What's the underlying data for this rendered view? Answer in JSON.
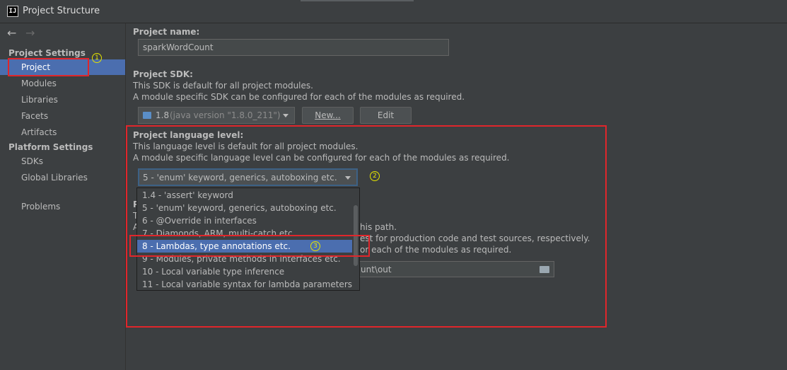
{
  "window": {
    "title": "Project Structure",
    "app_icon_text": "IJ"
  },
  "nav": {
    "back_icon": "arrow-left-icon",
    "forward_icon": "arrow-right-icon"
  },
  "sidebar": {
    "project_settings_header": "Project Settings",
    "project_items": [
      "Project",
      "Modules",
      "Libraries",
      "Facets",
      "Artifacts"
    ],
    "platform_settings_header": "Platform Settings",
    "platform_items": [
      "SDKs",
      "Global Libraries"
    ],
    "problems": "Problems",
    "selected": "Project"
  },
  "project_name": {
    "label": "Project name:",
    "value": "sparkWordCount"
  },
  "sdk": {
    "label": "Project SDK:",
    "desc1": "This SDK is default for all project modules.",
    "desc2": "A module specific SDK can be configured for each of the modules as required.",
    "selected_version": "1.8",
    "selected_detail": "(java version \"1.8.0_211\")",
    "new_button": "New...",
    "edit_button": "Edit"
  },
  "language_level": {
    "label": "Project language level:",
    "desc1": "This language level is default for all project modules.",
    "desc2": "A module specific language level can be configured for each of the modules as required.",
    "selected": "5 - 'enum' keyword, generics, autoboxing etc.",
    "options": [
      "1.4 - 'assert' keyword",
      "5 - 'enum' keyword, generics, autoboxing etc.",
      "6 - @Override in interfaces",
      "7 - Diamonds, ARM, multi-catch etc.",
      "8 - Lambdas, type annotations etc.",
      "9 - Modules, private methods in interfaces etc.",
      "10 - Local variable type inference",
      "11 - Local variable syntax for lambda parameters"
    ],
    "highlighted": "8 - Lambdas, type annotations etc."
  },
  "compiler_output": {
    "label_fragment": "P",
    "line_fragment_t": "T",
    "line_fragment_a": "A",
    "line1_tail": "his path.",
    "line2_tail": "est for production code and test sources, respectively.",
    "line3_tail": "or each of the modules as required.",
    "path_tail": "unt\\out",
    "folder_icon": "folder-icon"
  },
  "annotations": {
    "m1": "1",
    "m2": "2",
    "m3": "3"
  },
  "colors": {
    "selection": "#4b6eaf",
    "annotation_red": "#e0262b",
    "annotation_yellow": "#e5e500"
  }
}
